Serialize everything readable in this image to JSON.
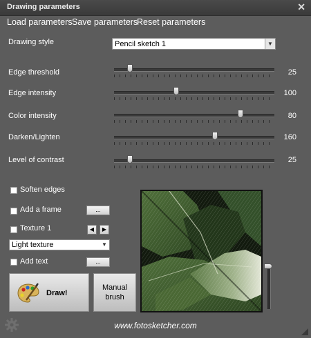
{
  "window": {
    "title": "Drawing parameters",
    "close_glyph": "✕"
  },
  "menu": {
    "load": "Load parameters",
    "save": "Save parameters",
    "reset": "Reset parameters"
  },
  "drawing_style": {
    "label": "Drawing style",
    "value": "Pencil sketch 1"
  },
  "sliders": [
    {
      "label": "Edge threshold",
      "value": "25",
      "position": 0.1
    },
    {
      "label": "Edge intensity",
      "value": "100",
      "position": 0.39
    },
    {
      "label": "Color intensity",
      "value": "80",
      "position": 0.79
    },
    {
      "label": "Darken/Lighten",
      "value": "160",
      "position": 0.63
    },
    {
      "label": "Level of contrast",
      "value": "25",
      "position": 0.1
    }
  ],
  "options": {
    "soften_edges": "Soften edges",
    "add_frame": "Add a frame",
    "texture": "Texture 1",
    "texture_select": "Light texture",
    "add_text": "Add text",
    "more_label": "...",
    "prev_glyph": "◀",
    "next_glyph": "▶"
  },
  "buttons": {
    "draw": "Draw!",
    "manual_brush_line1": "Manual",
    "manual_brush_line2": "brush"
  },
  "preview_zoom_level": 0.0,
  "footer": {
    "url": "www.fotosketcher.com"
  },
  "colors": {
    "background": "#5c5c5c",
    "titlebar": "#3f3f3f",
    "leaf_green": "#3e5a2e",
    "dark_bg": "#0f140b"
  }
}
